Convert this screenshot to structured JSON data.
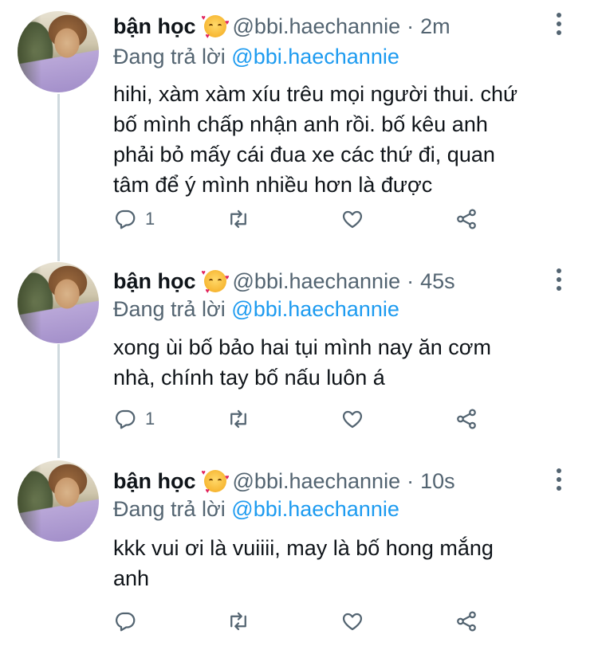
{
  "tweets": [
    {
      "name": "bận học",
      "handle": "@bbi.haechannie",
      "separator": "·",
      "time": "2m",
      "replying_prefix": "Đang trả lời",
      "replying_to": "@bbi.haechannie",
      "lines": [
        "hihi, xàm xàm xíu trêu mọi người thui. chứ",
        "bố mình chấp nhận anh rồi. bố kêu anh",
        "phải bỏ mấy cái đua xe các thứ đi, quan",
        "tâm để ý mình nhiều hơn là được"
      ],
      "reply_count": "1"
    },
    {
      "name": "bận học",
      "handle": "@bbi.haechannie",
      "separator": "·",
      "time": "45s",
      "replying_prefix": "Đang trả lời",
      "replying_to": "@bbi.haechannie",
      "lines": [
        "xong ùi bố bảo hai tụi mình nay ăn cơm",
        "nhà, chính tay bố nấu luôn á"
      ],
      "reply_count": "1"
    },
    {
      "name": "bận học",
      "handle": "@bbi.haechannie",
      "separator": "·",
      "time": "10s",
      "replying_prefix": "Đang trả lời",
      "replying_to": "@bbi.haechannie",
      "lines": [
        "kkk vui ơi là vuiiii, may là bố hong mắng",
        "anh"
      ],
      "reply_count": ""
    }
  ],
  "icons": {
    "avatar": "profile-photo",
    "emoji": "smiling-face-with-hearts",
    "more": "more-vertical-icon",
    "reply": "reply-icon",
    "retweet": "retweet-icon",
    "like": "heart-icon",
    "share": "share-icon"
  },
  "colors": {
    "text": "#0f1419",
    "secondary": "#536471",
    "link": "#1d9bf0",
    "thread_line": "#cfd9de"
  }
}
